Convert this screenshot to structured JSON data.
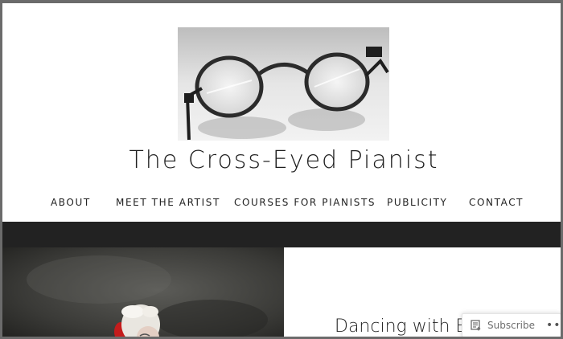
{
  "site": {
    "title": "The Cross-Eyed Pianist"
  },
  "header_image": {
    "description_icon": "spectacles-image"
  },
  "nav": {
    "items": [
      {
        "label": "ABOUT"
      },
      {
        "label": "MEET THE ARTIST"
      },
      {
        "label": "COURSES FOR PIANISTS"
      },
      {
        "label": "PUBLICITY"
      },
      {
        "label": "CONTACT"
      }
    ]
  },
  "post": {
    "title": "Dancing with E"
  },
  "subscribe_widget": {
    "label": "Subscribe",
    "more_label": "•••",
    "icon": "reader-icon"
  },
  "colors": {
    "band": "#222222",
    "frame": "#6b6b6b",
    "text": "#222222"
  }
}
